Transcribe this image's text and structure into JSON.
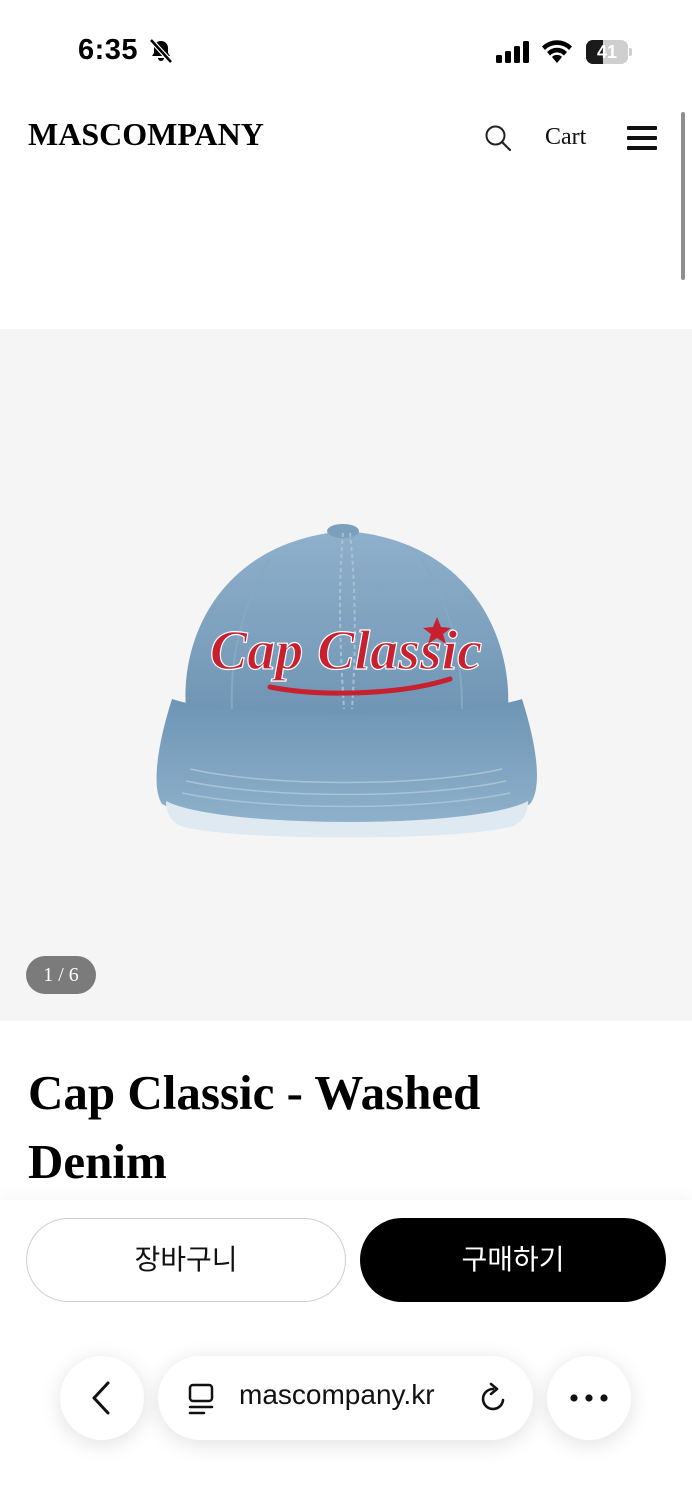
{
  "status_bar": {
    "time": "6:35",
    "battery_percent": "41",
    "battery_level": 0.41
  },
  "header": {
    "logo": "MASCOMPANY",
    "cart_label": "Cart"
  },
  "gallery": {
    "counter": "1 / 6",
    "current_index": 1,
    "total": 6,
    "embroidery_text": "Cap Classic"
  },
  "product": {
    "title": "Cap Classic - Washed Denim"
  },
  "actions": {
    "cart_label": "장바구니",
    "buy_label": "구매하기"
  },
  "browser": {
    "url": "mascompany.kr"
  },
  "colors": {
    "denim": "#7fa3c0",
    "embroidery": "#c8202f",
    "buy_button": "#000000",
    "gallery_bg": "#f5f5f5"
  }
}
